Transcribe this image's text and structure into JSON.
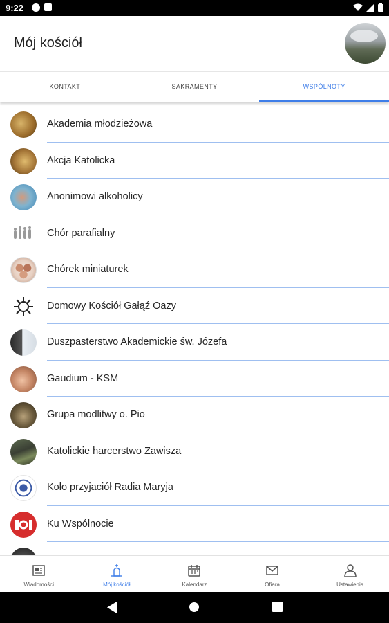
{
  "status_bar": {
    "time": "9:22"
  },
  "app_bar": {
    "title": "Mój kościół",
    "avatar_icon": "church-photo-avatar"
  },
  "tabs": [
    {
      "label": "KONTAKT",
      "active": false
    },
    {
      "label": "SAKRAMENTY",
      "active": false
    },
    {
      "label": "WSPÓLNOTY",
      "active": true
    }
  ],
  "communities": [
    {
      "label": "Akademia młodzieżowa",
      "icon": "group-photo-icon"
    },
    {
      "label": "Akcja Katolicka",
      "icon": "group-photo-icon"
    },
    {
      "label": "Anonimowi alkoholicy",
      "icon": "group-photo-icon"
    },
    {
      "label": "Chór parafialny",
      "icon": "choir-icon"
    },
    {
      "label": "Chórek miniaturek",
      "icon": "kids-choir-icon"
    },
    {
      "label": "Domowy Kościół Gałąź Oazy",
      "icon": "oaza-logo-icon"
    },
    {
      "label": "Duszpasterstwo Akademickie św. Józefa",
      "icon": "group-photo-icon"
    },
    {
      "label": "Gaudium - KSM",
      "icon": "group-photo-icon"
    },
    {
      "label": "Grupa modlitwy o. Pio",
      "icon": "group-photo-icon"
    },
    {
      "label": "Katolickie harcerstwo Zawisza",
      "icon": "group-photo-icon"
    },
    {
      "label": "Koło przyjaciół Radia Maryja",
      "icon": "radio-maryja-logo-icon"
    },
    {
      "label": "Ku Wspólnocie",
      "icon": "ku-wspolnocie-logo-icon"
    }
  ],
  "bottom_nav": [
    {
      "label": "Wiadomości",
      "icon": "news-icon",
      "active": false
    },
    {
      "label": "Mój kościół",
      "icon": "church-icon",
      "active": true
    },
    {
      "label": "Kalendarz",
      "icon": "calendar-icon",
      "active": false
    },
    {
      "label": "Ofiara",
      "icon": "mail-icon",
      "active": false
    },
    {
      "label": "Ustawienia",
      "icon": "person-icon",
      "active": false
    }
  ],
  "colors": {
    "accent": "#3f7ee8",
    "separator": "#9fbff0"
  }
}
